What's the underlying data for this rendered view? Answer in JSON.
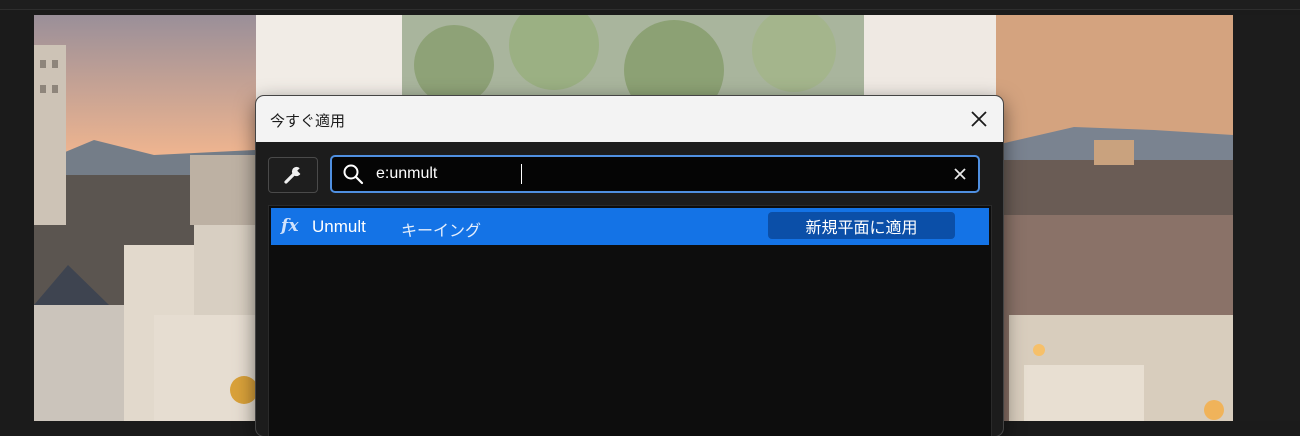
{
  "dialog": {
    "title": "今すぐ適用",
    "close_icon": "close-icon",
    "settings_icon": "wrench-icon"
  },
  "search": {
    "value": "e:unmult",
    "search_icon": "search-icon",
    "clear_icon": "clear-icon"
  },
  "results": [
    {
      "icon": "fx-icon",
      "icon_text": "fx",
      "name": "Unmult",
      "category": "キーイング",
      "action_label": "新規平面に適用"
    }
  ],
  "colors": {
    "accent": "#1473e6",
    "search_border": "#4f8fe0",
    "apply_button": "#0b4fa8",
    "dialog_header": "#f3f3f3",
    "results_background": "#0d0d0d"
  }
}
